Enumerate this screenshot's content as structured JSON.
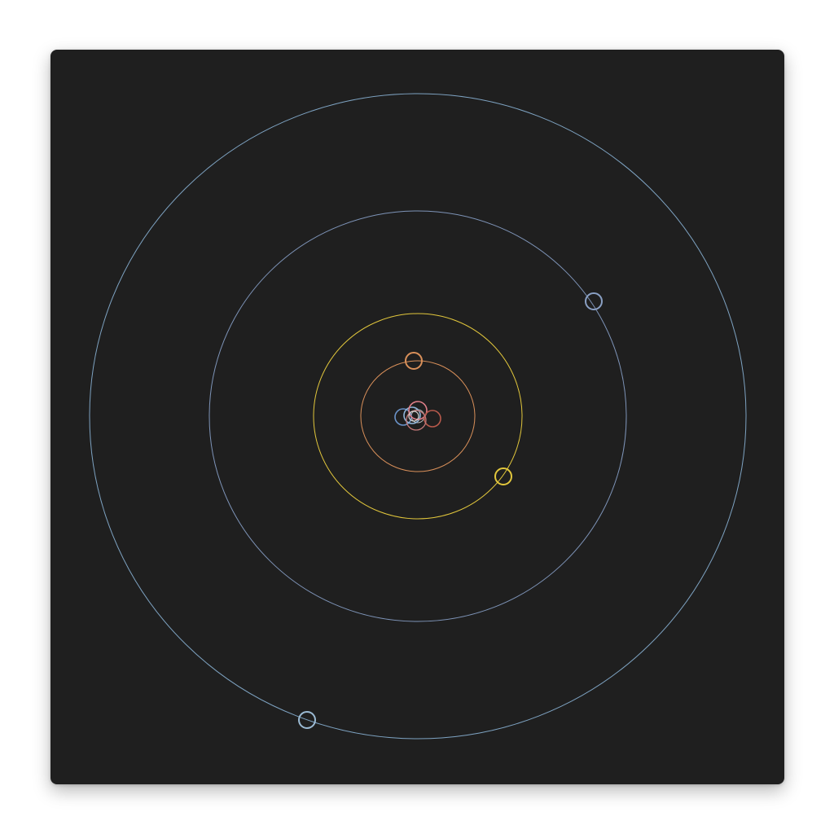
{
  "colors": {
    "page_background": "#ffffff",
    "panel_background": "#1f1f1f"
  },
  "orbits": [
    {
      "id": "orbit-1",
      "color": "#b8b8b8"
    },
    {
      "id": "orbit-2",
      "color": "#d9905a"
    },
    {
      "id": "orbit-3",
      "color": "#e2c73c"
    },
    {
      "id": "orbit-4",
      "color": "#7e94b8"
    },
    {
      "id": "orbit-5",
      "color": "#7ea3c2"
    }
  ],
  "bodies": [
    {
      "id": "central-cluster-blue",
      "color": "#6b93c9"
    },
    {
      "id": "central-cluster-cyan",
      "color": "#8fb5d9"
    },
    {
      "id": "central-cluster-pink",
      "color": "#e0808a"
    },
    {
      "id": "central-cluster-red",
      "color": "#b85a4c"
    },
    {
      "id": "central-cluster-rose",
      "color": "#c27878"
    },
    {
      "id": "central-cluster-light",
      "color": "#d8d8d8"
    },
    {
      "id": "planet-orange",
      "color": "#d9905a"
    },
    {
      "id": "planet-yellow",
      "color": "#e2c73c"
    },
    {
      "id": "planet-slate",
      "color": "#8aa0c4"
    },
    {
      "id": "planet-sky",
      "color": "#9bbad3"
    }
  ]
}
